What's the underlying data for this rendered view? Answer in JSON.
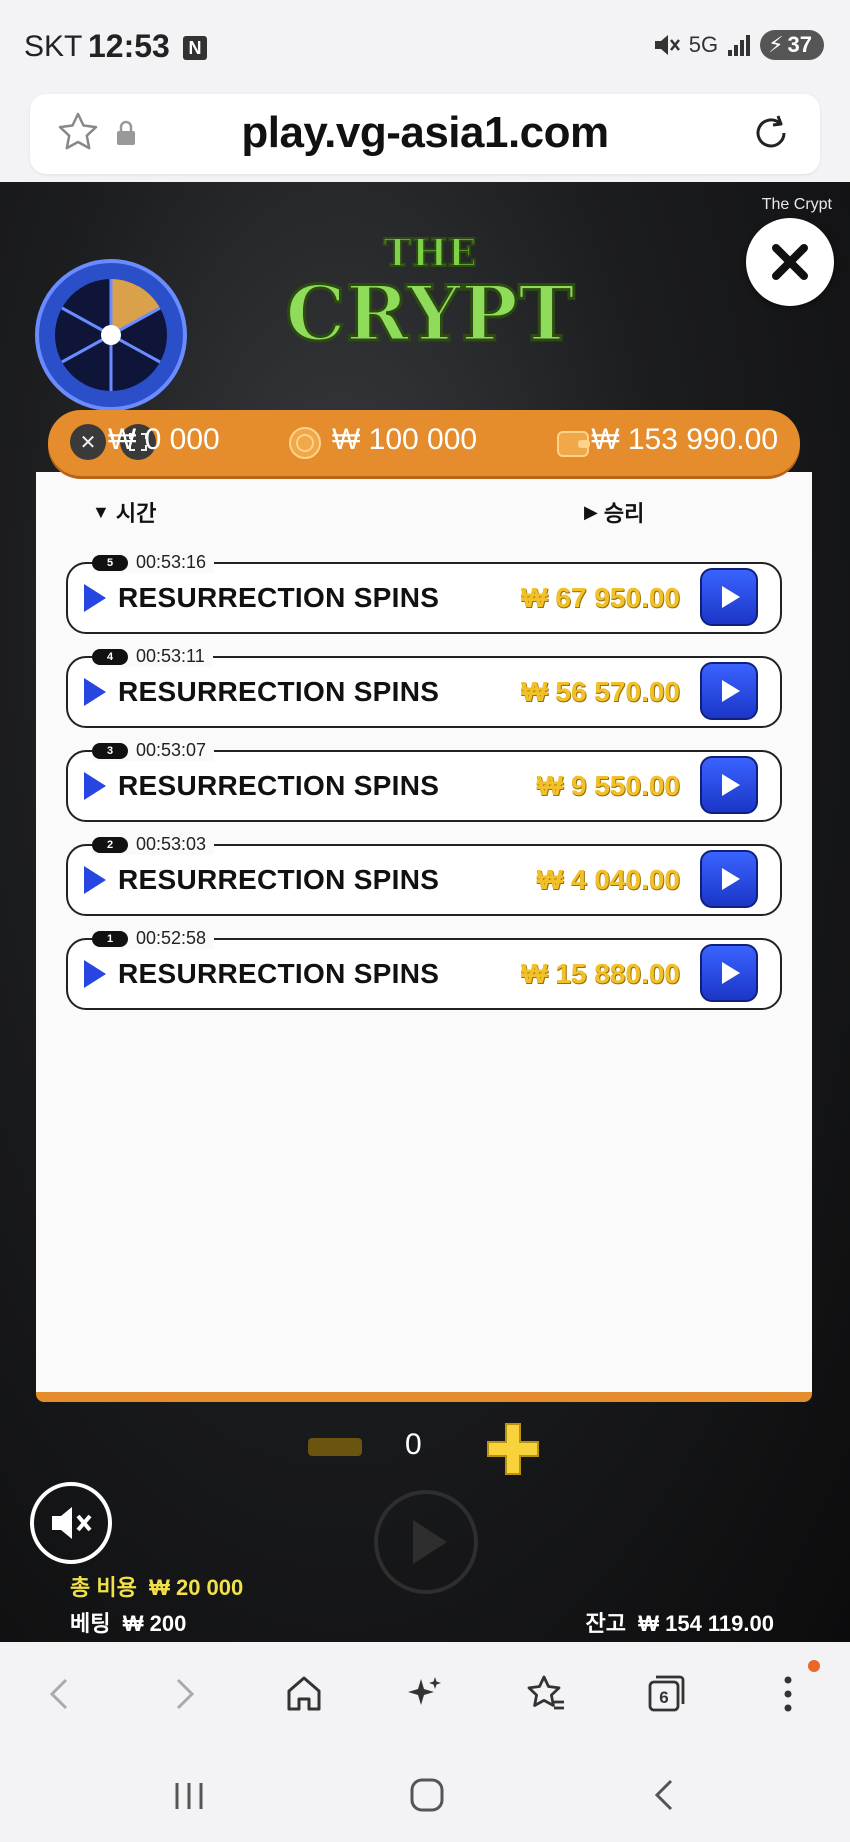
{
  "status": {
    "carrier": "SKT",
    "time": "12:53",
    "notif_badge": "N",
    "network": "5G",
    "battery": "37"
  },
  "browser": {
    "url": "play.vg-asia1.com"
  },
  "game": {
    "name": "The Crypt",
    "logo_top": "THE",
    "logo_main": "CRYPT",
    "header": {
      "bet_total": "₩ 0 000",
      "coin_bet": "₩ 100 000",
      "wallet_balance": "₩ 153 990.00"
    },
    "history": {
      "col_time": "시간",
      "col_win": "승리",
      "rows": [
        {
          "num": "5",
          "time": "00:53:16",
          "label": "RESURRECTION SPINS",
          "win": "₩ 67 950.00"
        },
        {
          "num": "4",
          "time": "00:53:11",
          "label": "RESURRECTION SPINS",
          "win": "₩ 56 570.00"
        },
        {
          "num": "3",
          "time": "00:53:07",
          "label": "RESURRECTION SPINS",
          "win": "₩ 9 550.00"
        },
        {
          "num": "2",
          "time": "00:53:03",
          "label": "RESURRECTION SPINS",
          "win": "₩ 4 040.00"
        },
        {
          "num": "1",
          "time": "00:52:58",
          "label": "RESURRECTION SPINS",
          "win": "₩ 15 880.00"
        }
      ]
    },
    "counter": "0",
    "total_cost_label": "총 비용",
    "total_cost_value": "₩ 20 000",
    "bet_label": "베팅",
    "bet_value": "₩ 200",
    "balance_label": "잔고",
    "balance_value": "₩ 154 119.00"
  },
  "bottom_nav": {
    "tabs_count": "6"
  },
  "colors": {
    "accent_orange": "#e58c2c",
    "replay_blue": "#2745e0",
    "win_gold": "#f2c12a"
  }
}
